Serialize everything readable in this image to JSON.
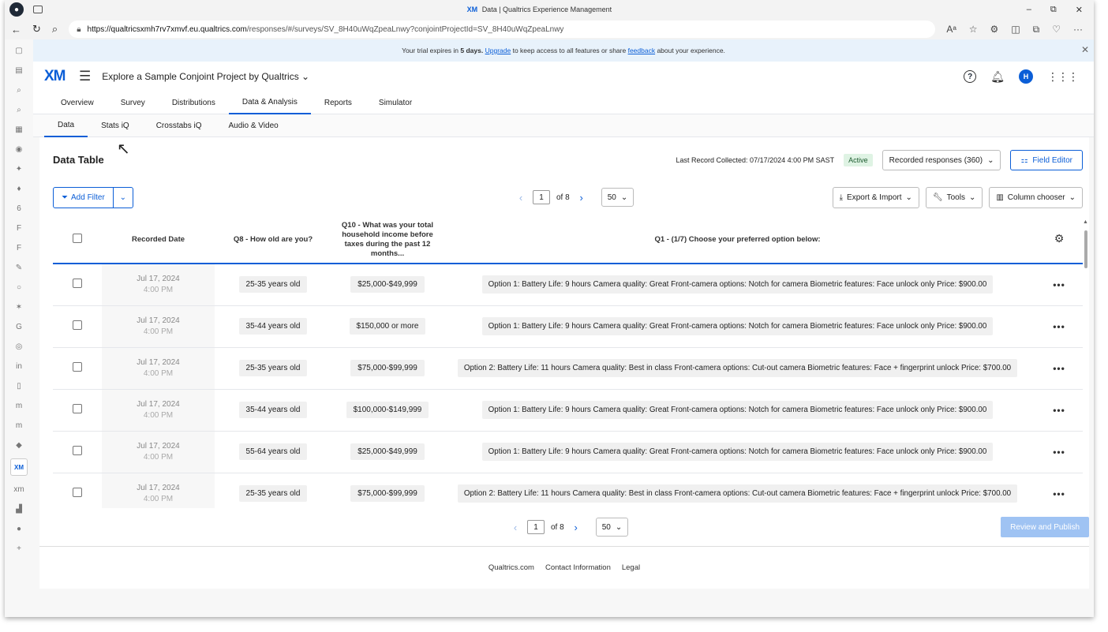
{
  "window": {
    "title_brand": "XM",
    "title": "Data | Qualtrics Experience Management",
    "controls": {
      "minimize": "–",
      "maximize": "⧉",
      "close": "✕"
    }
  },
  "addressbar": {
    "url_host": "https://qualtricsxmh7rv7xmvf.eu.qualtrics.com",
    "url_path": "/responses/#/surveys/SV_8H40uWqZpeaLnwy?conjointProjectId=SV_8H40uWqZpeaLnwy",
    "read_aloud": "Aᵃ",
    "more": "···"
  },
  "banner": {
    "prefix": "Your trial expires in ",
    "days": "5 days.",
    "space1": " ",
    "upgrade": "Upgrade",
    "middle": " to keep access to all features or share ",
    "feedback": "feedback",
    "suffix": " about your experience.",
    "close": "✕"
  },
  "header": {
    "logo": "XM",
    "project_name": "Explore a Sample Conjoint Project by Qualtrics",
    "help": "?",
    "avatar_initial": "H"
  },
  "main_tabs": [
    {
      "label": "Overview"
    },
    {
      "label": "Survey"
    },
    {
      "label": "Distributions"
    },
    {
      "label": "Data & Analysis",
      "active": true
    },
    {
      "label": "Reports"
    },
    {
      "label": "Simulator"
    }
  ],
  "sub_tabs": [
    {
      "label": "Data",
      "active": true
    },
    {
      "label": "Stats iQ"
    },
    {
      "label": "Crosstabs iQ"
    },
    {
      "label": "Audio & Video"
    }
  ],
  "data_table": {
    "title": "Data Table",
    "last_record": "Last Record Collected: 07/17/2024 4:00 PM SAST",
    "status": "Active",
    "responses_select": "Recorded responses (360)",
    "field_editor": "Field Editor"
  },
  "toolbar": {
    "add_filter": "Add Filter",
    "export_import": "Export & Import",
    "tools": "Tools",
    "column_chooser": "Column chooser"
  },
  "pager": {
    "page": "1",
    "of": "of 8",
    "size": "50"
  },
  "columns": {
    "recorded_date": "Recorded Date",
    "q8": "Q8 - How old are you?",
    "q10": "Q10 - What was your total household income before taxes during the past 12 months...",
    "q1": "Q1 - (1/7) Choose your preferred option below:"
  },
  "rows": [
    {
      "date": "Jul 17, 2024",
      "time": "4:00 PM",
      "age": "25-35 years old",
      "income": "$25,000-$49,999",
      "q1": "Option 1: Battery Life: 9 hours Camera quality: Great Front-camera options: Notch for camera Biometric features: Face unlock only Price: $900.00"
    },
    {
      "date": "Jul 17, 2024",
      "time": "4:00 PM",
      "age": "35-44 years old",
      "income": "$150,000 or more",
      "q1": "Option 1: Battery Life: 9 hours Camera quality: Great Front-camera options: Notch for camera Biometric features: Face unlock only Price: $900.00"
    },
    {
      "date": "Jul 17, 2024",
      "time": "4:00 PM",
      "age": "25-35 years old",
      "income": "$75,000-$99,999",
      "q1": "Option 2: Battery Life: 11 hours Camera quality: Best in class Front-camera options: Cut-out camera Biometric features: Face + fingerprint unlock Price: $700.00"
    },
    {
      "date": "Jul 17, 2024",
      "time": "4:00 PM",
      "age": "35-44 years old",
      "income": "$100,000-$149,999",
      "q1": "Option 1: Battery Life: 9 hours Camera quality: Great Front-camera options: Notch for camera Biometric features: Face unlock only Price: $900.00"
    },
    {
      "date": "Jul 17, 2024",
      "time": "4:00 PM",
      "age": "55-64 years old",
      "income": "$25,000-$49,999",
      "q1": "Option 1: Battery Life: 9 hours Camera quality: Great Front-camera options: Notch for camera Biometric features: Face unlock only Price: $900.00"
    },
    {
      "date": "Jul 17, 2024",
      "time": "4:00 PM",
      "age": "25-35 years old",
      "income": "$75,000-$99,999",
      "q1": "Option 2: Battery Life: 11 hours Camera quality: Best in class Front-camera options: Cut-out camera Biometric features: Face + fingerprint unlock Price: $700.00"
    }
  ],
  "review_publish": "Review and Publish",
  "footer": {
    "links": [
      "Qualtrics.com",
      "Contact Information",
      "Legal"
    ]
  },
  "sidebar_icons": [
    "6",
    "F",
    "F",
    "G"
  ],
  "colors": {
    "accent": "#0b5ed7",
    "active_badge_bg": "#dff3e4",
    "banner_bg": "#e8f2fb"
  }
}
